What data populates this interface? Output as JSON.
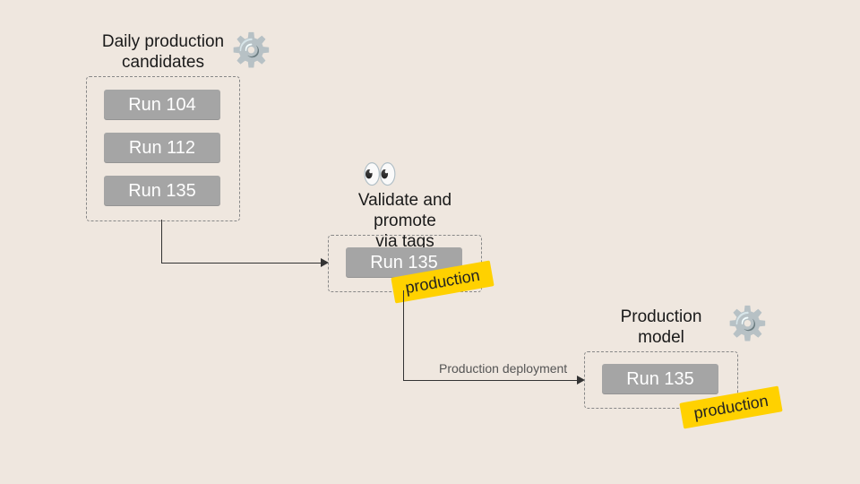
{
  "candidates": {
    "title": "Daily production\ncandidates",
    "runs": [
      "Run 104",
      "Run 112",
      "Run 135"
    ]
  },
  "validate": {
    "title": "Validate and promote\nvia tags",
    "run": "Run 135",
    "tag": "production",
    "arrow_caption": "Production deployment"
  },
  "production": {
    "title": "Production\nmodel",
    "run": "Run 135",
    "tag": "production"
  }
}
